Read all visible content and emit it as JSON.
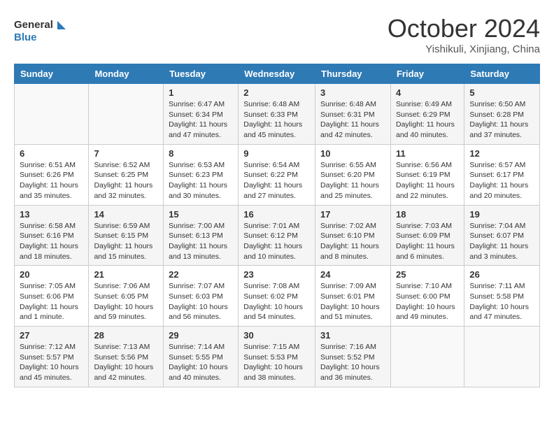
{
  "header": {
    "logo_line1": "General",
    "logo_line2": "Blue",
    "month": "October 2024",
    "location": "Yishikuli, Xinjiang, China"
  },
  "days_of_week": [
    "Sunday",
    "Monday",
    "Tuesday",
    "Wednesday",
    "Thursday",
    "Friday",
    "Saturday"
  ],
  "weeks": [
    [
      {
        "day": "",
        "info": ""
      },
      {
        "day": "",
        "info": ""
      },
      {
        "day": "1",
        "info": "Sunrise: 6:47 AM\nSunset: 6:34 PM\nDaylight: 11 hours and 47 minutes."
      },
      {
        "day": "2",
        "info": "Sunrise: 6:48 AM\nSunset: 6:33 PM\nDaylight: 11 hours and 45 minutes."
      },
      {
        "day": "3",
        "info": "Sunrise: 6:48 AM\nSunset: 6:31 PM\nDaylight: 11 hours and 42 minutes."
      },
      {
        "day": "4",
        "info": "Sunrise: 6:49 AM\nSunset: 6:29 PM\nDaylight: 11 hours and 40 minutes."
      },
      {
        "day": "5",
        "info": "Sunrise: 6:50 AM\nSunset: 6:28 PM\nDaylight: 11 hours and 37 minutes."
      }
    ],
    [
      {
        "day": "6",
        "info": "Sunrise: 6:51 AM\nSunset: 6:26 PM\nDaylight: 11 hours and 35 minutes."
      },
      {
        "day": "7",
        "info": "Sunrise: 6:52 AM\nSunset: 6:25 PM\nDaylight: 11 hours and 32 minutes."
      },
      {
        "day": "8",
        "info": "Sunrise: 6:53 AM\nSunset: 6:23 PM\nDaylight: 11 hours and 30 minutes."
      },
      {
        "day": "9",
        "info": "Sunrise: 6:54 AM\nSunset: 6:22 PM\nDaylight: 11 hours and 27 minutes."
      },
      {
        "day": "10",
        "info": "Sunrise: 6:55 AM\nSunset: 6:20 PM\nDaylight: 11 hours and 25 minutes."
      },
      {
        "day": "11",
        "info": "Sunrise: 6:56 AM\nSunset: 6:19 PM\nDaylight: 11 hours and 22 minutes."
      },
      {
        "day": "12",
        "info": "Sunrise: 6:57 AM\nSunset: 6:17 PM\nDaylight: 11 hours and 20 minutes."
      }
    ],
    [
      {
        "day": "13",
        "info": "Sunrise: 6:58 AM\nSunset: 6:16 PM\nDaylight: 11 hours and 18 minutes."
      },
      {
        "day": "14",
        "info": "Sunrise: 6:59 AM\nSunset: 6:15 PM\nDaylight: 11 hours and 15 minutes."
      },
      {
        "day": "15",
        "info": "Sunrise: 7:00 AM\nSunset: 6:13 PM\nDaylight: 11 hours and 13 minutes."
      },
      {
        "day": "16",
        "info": "Sunrise: 7:01 AM\nSunset: 6:12 PM\nDaylight: 11 hours and 10 minutes."
      },
      {
        "day": "17",
        "info": "Sunrise: 7:02 AM\nSunset: 6:10 PM\nDaylight: 11 hours and 8 minutes."
      },
      {
        "day": "18",
        "info": "Sunrise: 7:03 AM\nSunset: 6:09 PM\nDaylight: 11 hours and 6 minutes."
      },
      {
        "day": "19",
        "info": "Sunrise: 7:04 AM\nSunset: 6:07 PM\nDaylight: 11 hours and 3 minutes."
      }
    ],
    [
      {
        "day": "20",
        "info": "Sunrise: 7:05 AM\nSunset: 6:06 PM\nDaylight: 11 hours and 1 minute."
      },
      {
        "day": "21",
        "info": "Sunrise: 7:06 AM\nSunset: 6:05 PM\nDaylight: 10 hours and 59 minutes."
      },
      {
        "day": "22",
        "info": "Sunrise: 7:07 AM\nSunset: 6:03 PM\nDaylight: 10 hours and 56 minutes."
      },
      {
        "day": "23",
        "info": "Sunrise: 7:08 AM\nSunset: 6:02 PM\nDaylight: 10 hours and 54 minutes."
      },
      {
        "day": "24",
        "info": "Sunrise: 7:09 AM\nSunset: 6:01 PM\nDaylight: 10 hours and 51 minutes."
      },
      {
        "day": "25",
        "info": "Sunrise: 7:10 AM\nSunset: 6:00 PM\nDaylight: 10 hours and 49 minutes."
      },
      {
        "day": "26",
        "info": "Sunrise: 7:11 AM\nSunset: 5:58 PM\nDaylight: 10 hours and 47 minutes."
      }
    ],
    [
      {
        "day": "27",
        "info": "Sunrise: 7:12 AM\nSunset: 5:57 PM\nDaylight: 10 hours and 45 minutes."
      },
      {
        "day": "28",
        "info": "Sunrise: 7:13 AM\nSunset: 5:56 PM\nDaylight: 10 hours and 42 minutes."
      },
      {
        "day": "29",
        "info": "Sunrise: 7:14 AM\nSunset: 5:55 PM\nDaylight: 10 hours and 40 minutes."
      },
      {
        "day": "30",
        "info": "Sunrise: 7:15 AM\nSunset: 5:53 PM\nDaylight: 10 hours and 38 minutes."
      },
      {
        "day": "31",
        "info": "Sunrise: 7:16 AM\nSunset: 5:52 PM\nDaylight: 10 hours and 36 minutes."
      },
      {
        "day": "",
        "info": ""
      },
      {
        "day": "",
        "info": ""
      }
    ]
  ]
}
